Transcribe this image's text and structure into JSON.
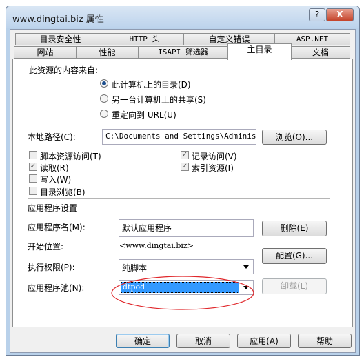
{
  "window": {
    "title": "www.dingtai.biz 属性",
    "help_icon": "?",
    "close_icon": "X"
  },
  "tabs_row1": [
    {
      "label": "目录安全性"
    },
    {
      "label": "HTTP 头"
    },
    {
      "label": "自定义错误"
    },
    {
      "label": "ASP.NET"
    }
  ],
  "tabs_row2": [
    {
      "label": "网站"
    },
    {
      "label": "性能"
    },
    {
      "label": "ISAPI 筛选器"
    },
    {
      "label": "主目录",
      "active": true
    },
    {
      "label": "文档"
    }
  ],
  "content_source": {
    "label": "此资源的内容来自:",
    "options": [
      {
        "label": "此计算机上的目录(D)",
        "selected": true
      },
      {
        "label": "另一台计算机上的共享(S)",
        "selected": false
      },
      {
        "label": "重定向到 URL(U)",
        "selected": false
      }
    ]
  },
  "local_path": {
    "label": "本地路径(C):",
    "value": "C:\\Documents and Settings\\Adminis",
    "browse_label": "浏览(O)..."
  },
  "checkboxes_left": [
    {
      "label": "脚本资源访问(T)",
      "checked": false
    },
    {
      "label": "读取(R)",
      "checked": true
    },
    {
      "label": "写入(W)",
      "checked": false
    },
    {
      "label": "目录浏览(B)",
      "checked": false
    }
  ],
  "checkboxes_right": [
    {
      "label": "记录访问(V)",
      "checked": true
    },
    {
      "label": "索引资源(I)",
      "checked": true
    }
  ],
  "app_settings": {
    "heading": "应用程序设置",
    "app_name_label": "应用程序名(M):",
    "app_name_value": "默认应用程序",
    "remove_label": "删除(E)",
    "start_label": "开始位置:",
    "start_value": "<www.dingtai.biz>",
    "config_label": "配置(G)...",
    "exec_label": "执行权限(P):",
    "exec_value": "纯脚本",
    "pool_label": "应用程序池(N):",
    "pool_value": "dtpod",
    "unload_label": "卸载(L)"
  },
  "footer": {
    "ok": "确定",
    "cancel": "取消",
    "apply": "应用(A)",
    "help": "帮助"
  },
  "colors": {
    "highlight": "#3399ff",
    "annotation": "#e0282c"
  }
}
